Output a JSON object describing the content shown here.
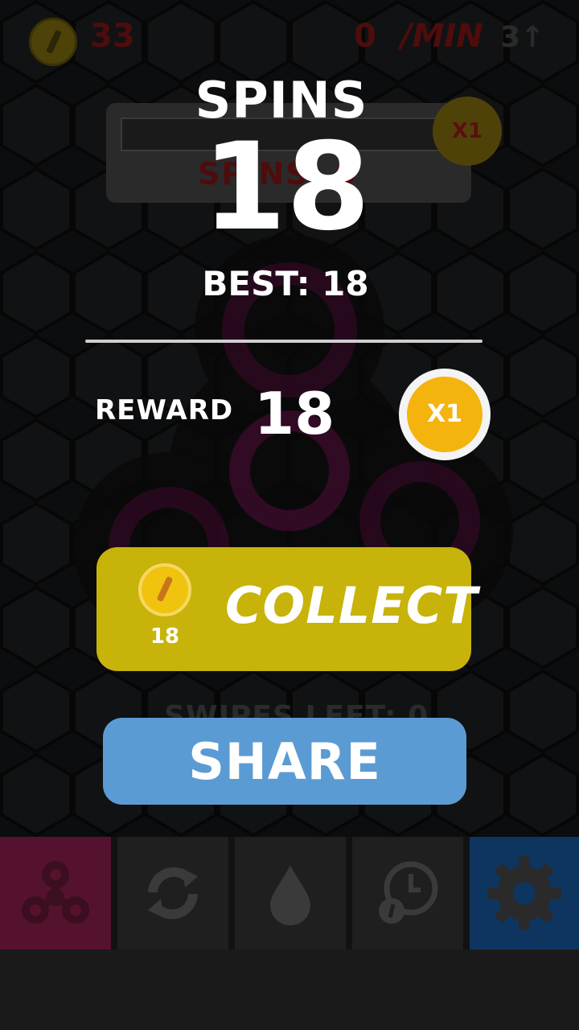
{
  "hud": {
    "coins": "33",
    "rate": "0",
    "rate_unit": "/MIN",
    "extra": "3↑"
  },
  "background_panel": {
    "multiplier": "X1",
    "spins_text": "SPINS: 0",
    "swipes_text": "SWIPES LEFT: 0"
  },
  "result": {
    "spins_label": "SPINS",
    "spins_value": "18",
    "best_text": "BEST: 18",
    "reward_label": "REWARD",
    "reward_value": "18",
    "multiplier": "X1"
  },
  "collect": {
    "amount": "18",
    "label": "COLLECT"
  },
  "share": {
    "label": "SHARE"
  },
  "toolbar": {
    "items": [
      "spinner-icon",
      "refresh-icon",
      "drop-icon",
      "timer-coin-icon",
      "gear-icon"
    ]
  },
  "colors": {
    "collect_button": "#c7b30a",
    "share_button": "#5b9bd3",
    "multiplier_badge": "#f5b40d",
    "toolbar_spinner": "#55122e",
    "toolbar_settings": "#0e3560"
  }
}
